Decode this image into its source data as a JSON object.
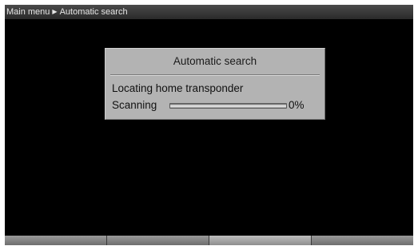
{
  "breadcrumb": {
    "root": "Main menu",
    "separator": "▶",
    "current": "Automatic search"
  },
  "dialog": {
    "title": "Automatic search",
    "status": "Locating home transponder",
    "scan_label": "Scanning",
    "progress_percent": 0,
    "progress_text": "0%"
  },
  "softkeys": [
    {
      "label": "",
      "active": false
    },
    {
      "label": "",
      "active": false
    },
    {
      "label": "",
      "active": true
    },
    {
      "label": "",
      "active": false
    }
  ],
  "colors": {
    "background": "#000000",
    "dialog": "#b3b3b3",
    "progress_fill": "#3a6fd8"
  }
}
